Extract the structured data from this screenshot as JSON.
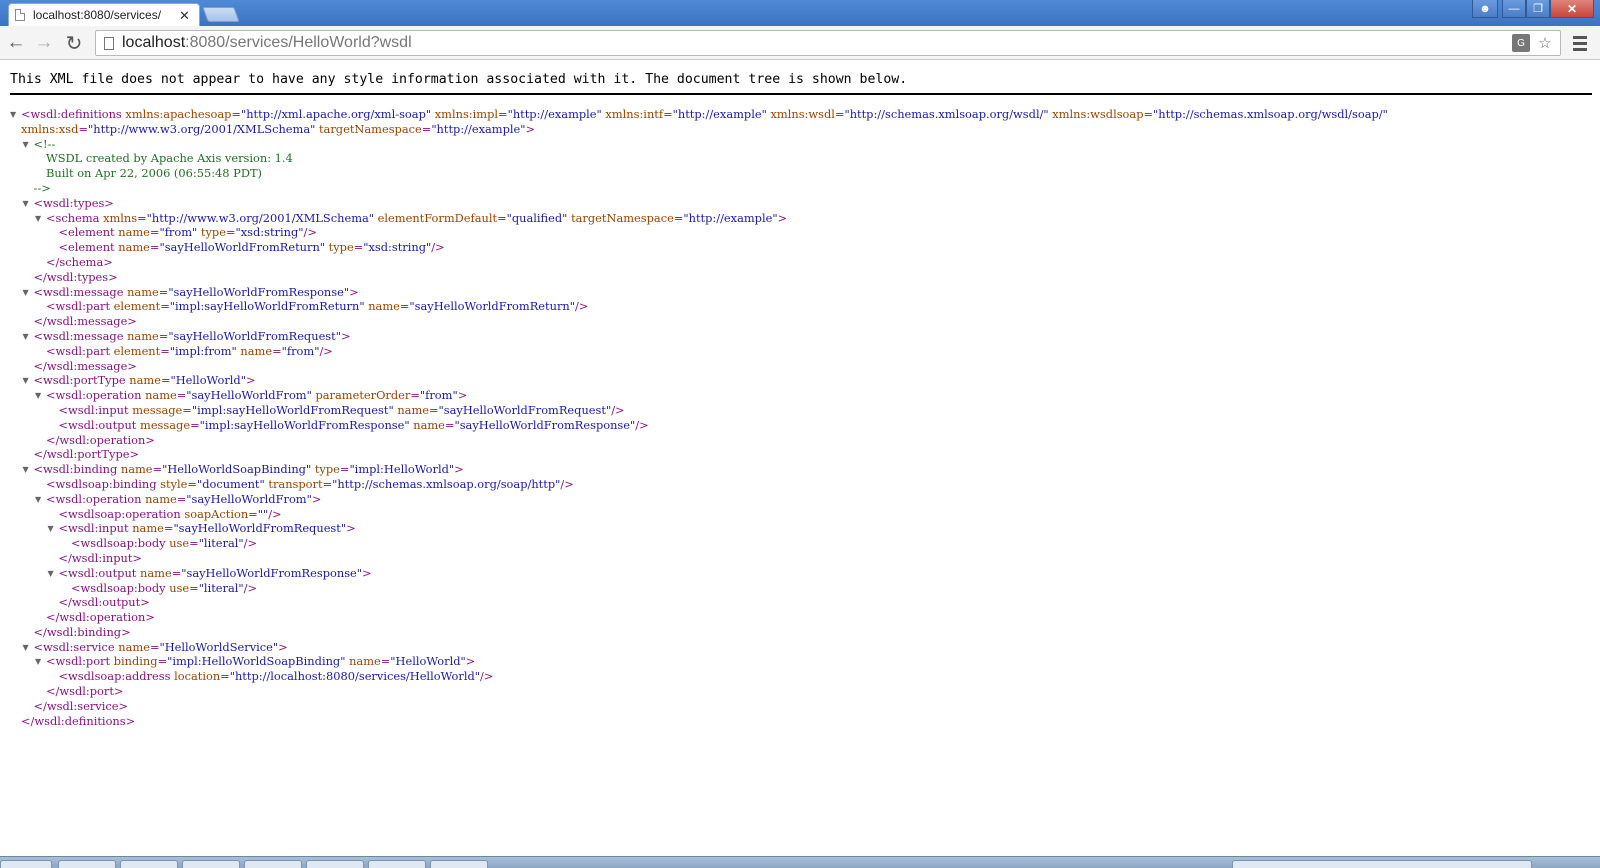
{
  "browser": {
    "tab_title": "localhost:8080/services/",
    "tab_close": "✕",
    "url_host": "localhost",
    "url_rest": ":8080/services/HelloWorld?wsdl",
    "icons": [
      "page-icon",
      "back-arrow-icon",
      "forward-arrow-icon",
      "reload-icon",
      "translate-icon",
      "star-icon",
      "menu-icon"
    ]
  },
  "notice": "This XML file does not appear to have any style information associated with it. The document tree is shown below.",
  "xml_lines": [
    {
      "indent": 0,
      "arrow": true,
      "segs": [
        [
          "t",
          "<wsdl:definitions "
        ],
        [
          "n",
          "xmlns:apachesoap"
        ],
        [
          "t",
          "="
        ],
        [
          "v",
          "\"http://xml.apache.org/xml-soap\""
        ],
        [
          "t",
          " "
        ],
        [
          "n",
          "xmlns:impl"
        ],
        [
          "t",
          "="
        ],
        [
          "v",
          "\"http://example\""
        ],
        [
          "t",
          " "
        ],
        [
          "n",
          "xmlns:intf"
        ],
        [
          "t",
          "="
        ],
        [
          "v",
          "\"http://example\""
        ],
        [
          "t",
          " "
        ],
        [
          "n",
          "xmlns:wsdl"
        ],
        [
          "t",
          "="
        ],
        [
          "v",
          "\"http://schemas.xmlsoap.org/wsdl/\""
        ],
        [
          "t",
          " "
        ],
        [
          "n",
          "xmlns:wsdlsoap"
        ],
        [
          "t",
          "="
        ],
        [
          "v",
          "\"http://schemas.xmlsoap.org/wsdl/soap/\""
        ]
      ]
    },
    {
      "indent": 0,
      "arrow": false,
      "segs": [
        [
          "n",
          "xmlns:xsd"
        ],
        [
          "t",
          "="
        ],
        [
          "v",
          "\"http://www.w3.org/2001/XMLSchema\""
        ],
        [
          "t",
          " "
        ],
        [
          "n",
          "targetNamespace"
        ],
        [
          "t",
          "="
        ],
        [
          "v",
          "\"http://example\""
        ],
        [
          "t",
          ">"
        ]
      ]
    },
    {
      "indent": 1,
      "arrow": true,
      "segs": [
        [
          "c",
          "<!--"
        ]
      ]
    },
    {
      "indent": 2,
      "arrow": false,
      "segs": [
        [
          "c",
          "WSDL created by Apache Axis version: 1.4"
        ]
      ]
    },
    {
      "indent": 2,
      "arrow": false,
      "segs": [
        [
          "c",
          "Built on Apr 22, 2006 (06:55:48 PDT)"
        ]
      ]
    },
    {
      "indent": 1,
      "arrow": false,
      "segs": [
        [
          "c",
          "-->"
        ]
      ]
    },
    {
      "indent": 1,
      "arrow": true,
      "segs": [
        [
          "t",
          "<wsdl:types>"
        ]
      ]
    },
    {
      "indent": 2,
      "arrow": true,
      "segs": [
        [
          "t",
          "<schema "
        ],
        [
          "n",
          "xmlns"
        ],
        [
          "t",
          "="
        ],
        [
          "v",
          "\"http://www.w3.org/2001/XMLSchema\""
        ],
        [
          "t",
          " "
        ],
        [
          "n",
          "elementFormDefault"
        ],
        [
          "t",
          "="
        ],
        [
          "v",
          "\"qualified\""
        ],
        [
          "t",
          " "
        ],
        [
          "n",
          "targetNamespace"
        ],
        [
          "t",
          "="
        ],
        [
          "v",
          "\"http://example\""
        ],
        [
          "t",
          ">"
        ]
      ]
    },
    {
      "indent": 3,
      "arrow": false,
      "segs": [
        [
          "t",
          "<element "
        ],
        [
          "n",
          "name"
        ],
        [
          "t",
          "="
        ],
        [
          "v",
          "\"from\""
        ],
        [
          "t",
          " "
        ],
        [
          "n",
          "type"
        ],
        [
          "t",
          "="
        ],
        [
          "v",
          "\"xsd:string\""
        ],
        [
          "t",
          "/>"
        ]
      ]
    },
    {
      "indent": 3,
      "arrow": false,
      "segs": [
        [
          "t",
          "<element "
        ],
        [
          "n",
          "name"
        ],
        [
          "t",
          "="
        ],
        [
          "v",
          "\"sayHelloWorldFromReturn\""
        ],
        [
          "t",
          " "
        ],
        [
          "n",
          "type"
        ],
        [
          "t",
          "="
        ],
        [
          "v",
          "\"xsd:string\""
        ],
        [
          "t",
          "/>"
        ]
      ]
    },
    {
      "indent": 2,
      "arrow": false,
      "segs": [
        [
          "t",
          "</schema>"
        ]
      ]
    },
    {
      "indent": 1,
      "arrow": false,
      "segs": [
        [
          "t",
          "</wsdl:types>"
        ]
      ]
    },
    {
      "indent": 1,
      "arrow": true,
      "segs": [
        [
          "t",
          "<wsdl:message "
        ],
        [
          "n",
          "name"
        ],
        [
          "t",
          "="
        ],
        [
          "v",
          "\"sayHelloWorldFromResponse\""
        ],
        [
          "t",
          ">"
        ]
      ]
    },
    {
      "indent": 2,
      "arrow": false,
      "segs": [
        [
          "t",
          "<wsdl:part "
        ],
        [
          "n",
          "element"
        ],
        [
          "t",
          "="
        ],
        [
          "v",
          "\"impl:sayHelloWorldFromReturn\""
        ],
        [
          "t",
          " "
        ],
        [
          "n",
          "name"
        ],
        [
          "t",
          "="
        ],
        [
          "v",
          "\"sayHelloWorldFromReturn\""
        ],
        [
          "t",
          "/>"
        ]
      ]
    },
    {
      "indent": 1,
      "arrow": false,
      "segs": [
        [
          "t",
          "</wsdl:message>"
        ]
      ]
    },
    {
      "indent": 1,
      "arrow": true,
      "segs": [
        [
          "t",
          "<wsdl:message "
        ],
        [
          "n",
          "name"
        ],
        [
          "t",
          "="
        ],
        [
          "v",
          "\"sayHelloWorldFromRequest\""
        ],
        [
          "t",
          ">"
        ]
      ]
    },
    {
      "indent": 2,
      "arrow": false,
      "segs": [
        [
          "t",
          "<wsdl:part "
        ],
        [
          "n",
          "element"
        ],
        [
          "t",
          "="
        ],
        [
          "v",
          "\"impl:from\""
        ],
        [
          "t",
          " "
        ],
        [
          "n",
          "name"
        ],
        [
          "t",
          "="
        ],
        [
          "v",
          "\"from\""
        ],
        [
          "t",
          "/>"
        ]
      ]
    },
    {
      "indent": 1,
      "arrow": false,
      "segs": [
        [
          "t",
          "</wsdl:message>"
        ]
      ]
    },
    {
      "indent": 1,
      "arrow": true,
      "segs": [
        [
          "t",
          "<wsdl:portType "
        ],
        [
          "n",
          "name"
        ],
        [
          "t",
          "="
        ],
        [
          "v",
          "\"HelloWorld\""
        ],
        [
          "t",
          ">"
        ]
      ]
    },
    {
      "indent": 2,
      "arrow": true,
      "segs": [
        [
          "t",
          "<wsdl:operation "
        ],
        [
          "n",
          "name"
        ],
        [
          "t",
          "="
        ],
        [
          "v",
          "\"sayHelloWorldFrom\""
        ],
        [
          "t",
          " "
        ],
        [
          "n",
          "parameterOrder"
        ],
        [
          "t",
          "="
        ],
        [
          "v",
          "\"from\""
        ],
        [
          "t",
          ">"
        ]
      ]
    },
    {
      "indent": 3,
      "arrow": false,
      "segs": [
        [
          "t",
          "<wsdl:input "
        ],
        [
          "n",
          "message"
        ],
        [
          "t",
          "="
        ],
        [
          "v",
          "\"impl:sayHelloWorldFromRequest\""
        ],
        [
          "t",
          " "
        ],
        [
          "n",
          "name"
        ],
        [
          "t",
          "="
        ],
        [
          "v",
          "\"sayHelloWorldFromRequest\""
        ],
        [
          "t",
          "/>"
        ]
      ]
    },
    {
      "indent": 3,
      "arrow": false,
      "segs": [
        [
          "t",
          "<wsdl:output "
        ],
        [
          "n",
          "message"
        ],
        [
          "t",
          "="
        ],
        [
          "v",
          "\"impl:sayHelloWorldFromResponse\""
        ],
        [
          "t",
          " "
        ],
        [
          "n",
          "name"
        ],
        [
          "t",
          "="
        ],
        [
          "v",
          "\"sayHelloWorldFromResponse\""
        ],
        [
          "t",
          "/>"
        ]
      ]
    },
    {
      "indent": 2,
      "arrow": false,
      "segs": [
        [
          "t",
          "</wsdl:operation>"
        ]
      ]
    },
    {
      "indent": 1,
      "arrow": false,
      "segs": [
        [
          "t",
          "</wsdl:portType>"
        ]
      ]
    },
    {
      "indent": 1,
      "arrow": true,
      "segs": [
        [
          "t",
          "<wsdl:binding "
        ],
        [
          "n",
          "name"
        ],
        [
          "t",
          "="
        ],
        [
          "v",
          "\"HelloWorldSoapBinding\""
        ],
        [
          "t",
          " "
        ],
        [
          "n",
          "type"
        ],
        [
          "t",
          "="
        ],
        [
          "v",
          "\"impl:HelloWorld\""
        ],
        [
          "t",
          ">"
        ]
      ]
    },
    {
      "indent": 2,
      "arrow": false,
      "segs": [
        [
          "t",
          "<wsdlsoap:binding "
        ],
        [
          "n",
          "style"
        ],
        [
          "t",
          "="
        ],
        [
          "v",
          "\"document\""
        ],
        [
          "t",
          " "
        ],
        [
          "n",
          "transport"
        ],
        [
          "t",
          "="
        ],
        [
          "v",
          "\"http://schemas.xmlsoap.org/soap/http\""
        ],
        [
          "t",
          "/>"
        ]
      ]
    },
    {
      "indent": 2,
      "arrow": true,
      "segs": [
        [
          "t",
          "<wsdl:operation "
        ],
        [
          "n",
          "name"
        ],
        [
          "t",
          "="
        ],
        [
          "v",
          "\"sayHelloWorldFrom\""
        ],
        [
          "t",
          ">"
        ]
      ]
    },
    {
      "indent": 3,
      "arrow": false,
      "segs": [
        [
          "t",
          "<wsdlsoap:operation "
        ],
        [
          "n",
          "soapAction"
        ],
        [
          "t",
          "="
        ],
        [
          "v",
          "\"\""
        ],
        [
          "t",
          "/>"
        ]
      ]
    },
    {
      "indent": 3,
      "arrow": true,
      "segs": [
        [
          "t",
          "<wsdl:input "
        ],
        [
          "n",
          "name"
        ],
        [
          "t",
          "="
        ],
        [
          "v",
          "\"sayHelloWorldFromRequest\""
        ],
        [
          "t",
          ">"
        ]
      ]
    },
    {
      "indent": 4,
      "arrow": false,
      "segs": [
        [
          "t",
          "<wsdlsoap:body "
        ],
        [
          "n",
          "use"
        ],
        [
          "t",
          "="
        ],
        [
          "v",
          "\"literal\""
        ],
        [
          "t",
          "/>"
        ]
      ]
    },
    {
      "indent": 3,
      "arrow": false,
      "segs": [
        [
          "t",
          "</wsdl:input>"
        ]
      ]
    },
    {
      "indent": 3,
      "arrow": true,
      "segs": [
        [
          "t",
          "<wsdl:output "
        ],
        [
          "n",
          "name"
        ],
        [
          "t",
          "="
        ],
        [
          "v",
          "\"sayHelloWorldFromResponse\""
        ],
        [
          "t",
          ">"
        ]
      ]
    },
    {
      "indent": 4,
      "arrow": false,
      "segs": [
        [
          "t",
          "<wsdlsoap:body "
        ],
        [
          "n",
          "use"
        ],
        [
          "t",
          "="
        ],
        [
          "v",
          "\"literal\""
        ],
        [
          "t",
          "/>"
        ]
      ]
    },
    {
      "indent": 3,
      "arrow": false,
      "segs": [
        [
          "t",
          "</wsdl:output>"
        ]
      ]
    },
    {
      "indent": 2,
      "arrow": false,
      "segs": [
        [
          "t",
          "</wsdl:operation>"
        ]
      ]
    },
    {
      "indent": 1,
      "arrow": false,
      "segs": [
        [
          "t",
          "</wsdl:binding>"
        ]
      ]
    },
    {
      "indent": 1,
      "arrow": true,
      "segs": [
        [
          "t",
          "<wsdl:service "
        ],
        [
          "n",
          "name"
        ],
        [
          "t",
          "="
        ],
        [
          "v",
          "\"HelloWorldService\""
        ],
        [
          "t",
          ">"
        ]
      ]
    },
    {
      "indent": 2,
      "arrow": true,
      "segs": [
        [
          "t",
          "<wsdl:port "
        ],
        [
          "n",
          "binding"
        ],
        [
          "t",
          "="
        ],
        [
          "v",
          "\"impl:HelloWorldSoapBinding\""
        ],
        [
          "t",
          " "
        ],
        [
          "n",
          "name"
        ],
        [
          "t",
          "="
        ],
        [
          "v",
          "\"HelloWorld\""
        ],
        [
          "t",
          ">"
        ]
      ]
    },
    {
      "indent": 3,
      "arrow": false,
      "segs": [
        [
          "t",
          "<wsdlsoap:address "
        ],
        [
          "n",
          "location"
        ],
        [
          "t",
          "="
        ],
        [
          "v",
          "\"http://localhost:8080/services/HelloWorld\""
        ],
        [
          "t",
          "/>"
        ]
      ]
    },
    {
      "indent": 2,
      "arrow": false,
      "segs": [
        [
          "t",
          "</wsdl:port>"
        ]
      ]
    },
    {
      "indent": 1,
      "arrow": false,
      "segs": [
        [
          "t",
          "</wsdl:service>"
        ]
      ]
    },
    {
      "indent": 0,
      "arrow": false,
      "segs": [
        [
          "t",
          "</wsdl:definitions>"
        ]
      ]
    }
  ],
  "colors": {
    "tag": "#881280",
    "attr_name": "#994500",
    "attr_value": "#1a1aa6",
    "comment": "#236e25"
  }
}
